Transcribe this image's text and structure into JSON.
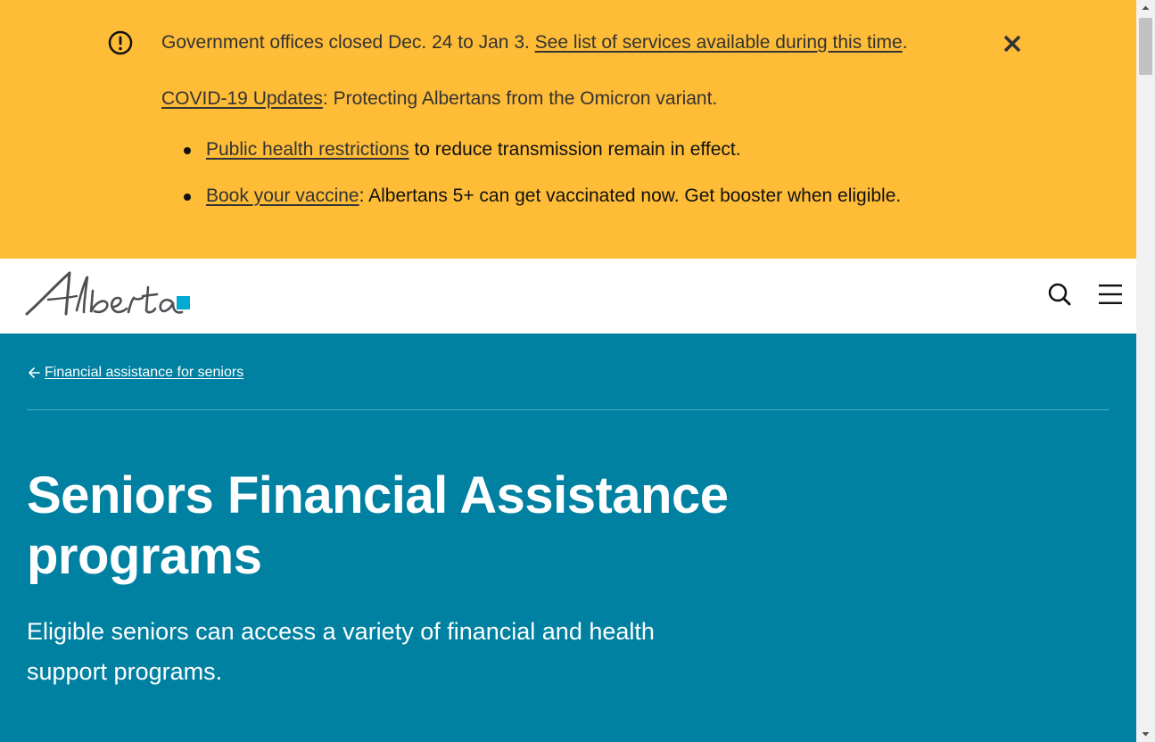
{
  "alert": {
    "closure_text": "Government offices closed Dec. 24 to Jan 3. ",
    "closure_link": "See list of services available during this time",
    "closure_period": ".",
    "covid_link": "COVID-19 Updates",
    "covid_text": ": Protecting Albertans from the Omicron variant.",
    "bullets": [
      {
        "link": "Public health restrictions",
        "text": " to reduce transmission remain in effect."
      },
      {
        "link": "Book your vaccine",
        "text": ": Albertans 5+ can get vaccinated now. Get booster when eligible."
      }
    ],
    "icon": "exclamation-circle-icon",
    "close_icon": "close-icon"
  },
  "header": {
    "logo_text": "Alberta",
    "search_icon": "search-icon",
    "menu_icon": "hamburger-menu-icon"
  },
  "hero": {
    "back_link": "Financial assistance for seniors",
    "title": "Seniors Financial Assistance programs",
    "lead": "Eligible seniors can access a variety of financial and health support programs."
  },
  "colors": {
    "alert_bg": "#febc37",
    "hero_bg": "#0081a2",
    "logo_accent": "#00aad2",
    "text_dark": "#333333"
  }
}
